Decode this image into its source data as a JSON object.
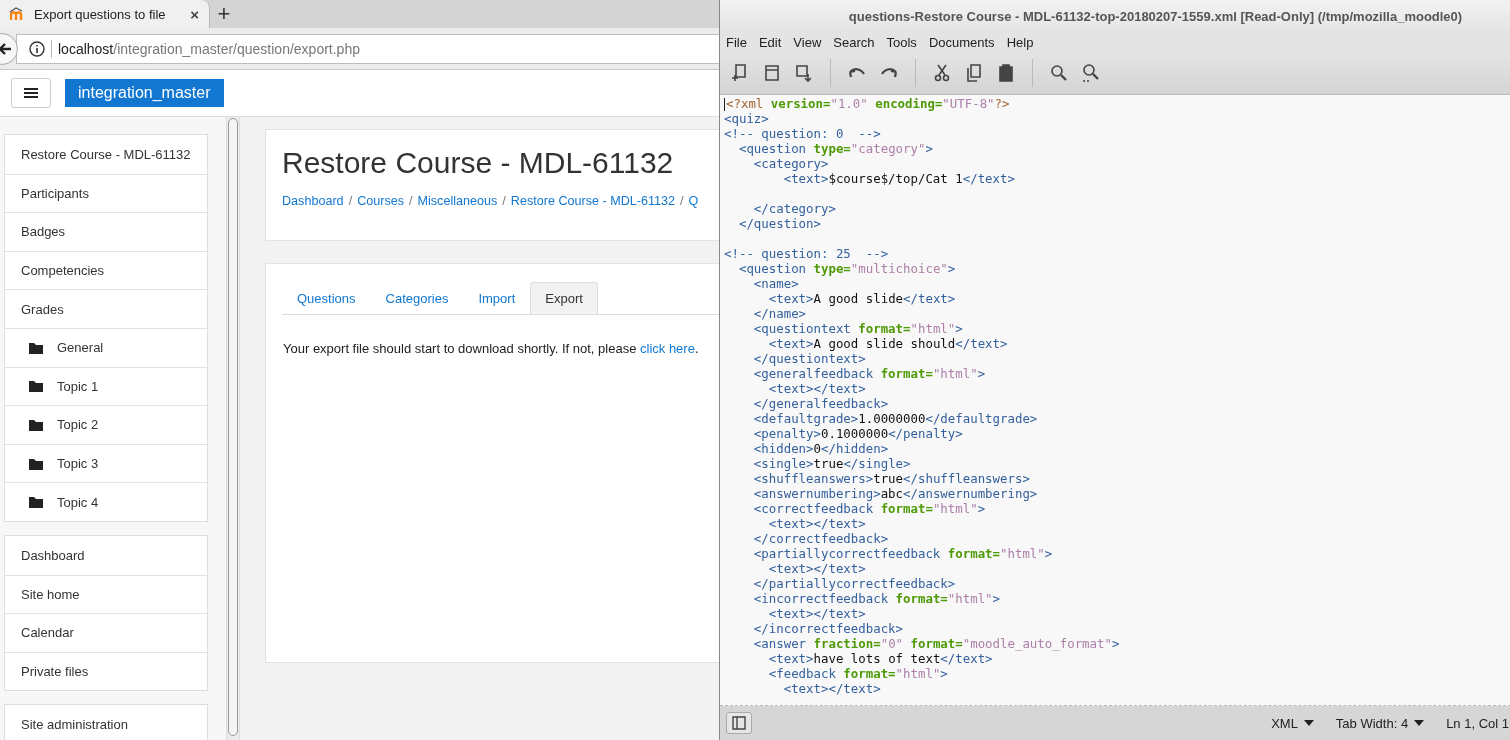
{
  "browser": {
    "tab": {
      "title": "Export questions to file",
      "close": "×"
    },
    "new_tab": "+",
    "address": {
      "host": "localhost",
      "path": "/integration_master/question/export.php"
    }
  },
  "navbar": {
    "brand": "integration_master"
  },
  "drawer": [
    {
      "items": [
        {
          "label": "Restore Course - MDL-61132",
          "kind": "link"
        },
        {
          "label": "Participants",
          "kind": "link"
        },
        {
          "label": "Badges",
          "kind": "link"
        },
        {
          "label": "Competencies",
          "kind": "link"
        },
        {
          "label": "Grades",
          "kind": "link"
        },
        {
          "label": "General",
          "kind": "folder"
        },
        {
          "label": "Topic 1",
          "kind": "folder"
        },
        {
          "label": "Topic 2",
          "kind": "folder"
        },
        {
          "label": "Topic 3",
          "kind": "folder"
        },
        {
          "label": "Topic 4",
          "kind": "folder"
        }
      ]
    },
    {
      "items": [
        {
          "label": "Dashboard",
          "kind": "link"
        },
        {
          "label": "Site home",
          "kind": "link"
        },
        {
          "label": "Calendar",
          "kind": "link"
        },
        {
          "label": "Private files",
          "kind": "link"
        }
      ]
    },
    {
      "items": [
        {
          "label": "Site administration",
          "kind": "link"
        }
      ]
    }
  ],
  "page": {
    "title": "Restore Course - MDL-61132",
    "breadcrumb": [
      {
        "label": "Dashboard",
        "separator": "/"
      },
      {
        "label": "Courses",
        "separator": "/"
      },
      {
        "label": "Miscellaneous",
        "separator": "/"
      },
      {
        "label": "Restore Course - MDL-61132",
        "separator": "/"
      },
      {
        "label": "Q"
      }
    ],
    "tabs": [
      {
        "label": "Questions",
        "selected": false
      },
      {
        "label": "Categories",
        "selected": false
      },
      {
        "label": "Import",
        "selected": false
      },
      {
        "label": "Export",
        "selected": true
      }
    ],
    "message": {
      "before": "Your export file should start to download shortly. If not, please ",
      "link": "click here",
      "after": "."
    }
  },
  "editor": {
    "title": "questions-Restore Course - MDL-61132-top-20180207-1559.xml [Read-Only] (/tmp/mozilla_moodle0)",
    "menu": [
      "File",
      "Edit",
      "View",
      "Search",
      "Tools",
      "Documents",
      "Help"
    ],
    "lines": [
      {
        "segments": [
          {
            "kind": "pi",
            "text": "<?xml "
          },
          {
            "kind": "attr",
            "text": "version="
          },
          {
            "kind": "val",
            "text": "\"1.0\" "
          },
          {
            "kind": "attr",
            "text": "encoding="
          },
          {
            "kind": "val",
            "text": "\"UTF-8\""
          },
          {
            "kind": "pi",
            "text": "?>"
          }
        ]
      },
      {
        "segments": [
          {
            "kind": "tag",
            "text": "<quiz>"
          }
        ]
      },
      {
        "segments": [
          {
            "kind": "com",
            "text": "<!-- question: 0  -->"
          }
        ]
      },
      {
        "segments": [
          {
            "kind": "tag",
            "text": "  <question "
          },
          {
            "kind": "attr",
            "text": "type="
          },
          {
            "kind": "val",
            "text": "\"category\""
          },
          {
            "kind": "tag",
            "text": ">"
          }
        ]
      },
      {
        "segments": [
          {
            "kind": "tag",
            "text": "    <category>"
          }
        ]
      },
      {
        "segments": [
          {
            "kind": "tag",
            "text": "        <text>"
          },
          {
            "kind": "txt",
            "text": "$course$/top/Cat 1"
          },
          {
            "kind": "tag",
            "text": "</text>"
          }
        ],
        "blank_after": true
      },
      {
        "segments": [
          {
            "kind": "tag",
            "text": "    </category>"
          }
        ]
      },
      {
        "segments": [
          {
            "kind": "tag",
            "text": "  </question>"
          }
        ],
        "blank_after": true
      },
      {
        "segments": [
          {
            "kind": "com",
            "text": "<!-- question: 25  -->"
          }
        ]
      },
      {
        "segments": [
          {
            "kind": "tag",
            "text": "  <question "
          },
          {
            "kind": "attr",
            "text": "type="
          },
          {
            "kind": "val",
            "text": "\"multichoice\""
          },
          {
            "kind": "tag",
            "text": ">"
          }
        ]
      },
      {
        "segments": [
          {
            "kind": "tag",
            "text": "    <name>"
          }
        ]
      },
      {
        "segments": [
          {
            "kind": "tag",
            "text": "      <text>"
          },
          {
            "kind": "txt",
            "text": "A good slide"
          },
          {
            "kind": "tag",
            "text": "</text>"
          }
        ]
      },
      {
        "segments": [
          {
            "kind": "tag",
            "text": "    </name>"
          }
        ]
      },
      {
        "segments": [
          {
            "kind": "tag",
            "text": "    <questiontext "
          },
          {
            "kind": "attr",
            "text": "format="
          },
          {
            "kind": "val",
            "text": "\"html\""
          },
          {
            "kind": "tag",
            "text": ">"
          }
        ]
      },
      {
        "segments": [
          {
            "kind": "tag",
            "text": "      <text>"
          },
          {
            "kind": "txt",
            "text": "A good slide should"
          },
          {
            "kind": "tag",
            "text": "</text>"
          }
        ]
      },
      {
        "segments": [
          {
            "kind": "tag",
            "text": "    </questiontext>"
          }
        ]
      },
      {
        "segments": [
          {
            "kind": "tag",
            "text": "    <generalfeedback "
          },
          {
            "kind": "attr",
            "text": "format="
          },
          {
            "kind": "val",
            "text": "\"html\""
          },
          {
            "kind": "tag",
            "text": ">"
          }
        ]
      },
      {
        "segments": [
          {
            "kind": "tag",
            "text": "      <text></text>"
          }
        ]
      },
      {
        "segments": [
          {
            "kind": "tag",
            "text": "    </generalfeedback>"
          }
        ]
      },
      {
        "segments": [
          {
            "kind": "tag",
            "text": "    <defaultgrade>"
          },
          {
            "kind": "txt",
            "text": "1.0000000"
          },
          {
            "kind": "tag",
            "text": "</defaultgrade>"
          }
        ]
      },
      {
        "segments": [
          {
            "kind": "tag",
            "text": "    <penalty>"
          },
          {
            "kind": "txt",
            "text": "0.1000000"
          },
          {
            "kind": "tag",
            "text": "</penalty>"
          }
        ]
      },
      {
        "segments": [
          {
            "kind": "tag",
            "text": "    <hidden>"
          },
          {
            "kind": "txt",
            "text": "0"
          },
          {
            "kind": "tag",
            "text": "</hidden>"
          }
        ]
      },
      {
        "segments": [
          {
            "kind": "tag",
            "text": "    <single>"
          },
          {
            "kind": "txt",
            "text": "true"
          },
          {
            "kind": "tag",
            "text": "</single>"
          }
        ]
      },
      {
        "segments": [
          {
            "kind": "tag",
            "text": "    <shuffleanswers>"
          },
          {
            "kind": "txt",
            "text": "true"
          },
          {
            "kind": "tag",
            "text": "</shuffleanswers>"
          }
        ]
      },
      {
        "segments": [
          {
            "kind": "tag",
            "text": "    <answernumbering>"
          },
          {
            "kind": "txt",
            "text": "abc"
          },
          {
            "kind": "tag",
            "text": "</answernumbering>"
          }
        ]
      },
      {
        "segments": [
          {
            "kind": "tag",
            "text": "    <correctfeedback "
          },
          {
            "kind": "attr",
            "text": "format="
          },
          {
            "kind": "val",
            "text": "\"html\""
          },
          {
            "kind": "tag",
            "text": ">"
          }
        ]
      },
      {
        "segments": [
          {
            "kind": "tag",
            "text": "      <text></text>"
          }
        ]
      },
      {
        "segments": [
          {
            "kind": "tag",
            "text": "    </correctfeedback>"
          }
        ]
      },
      {
        "segments": [
          {
            "kind": "tag",
            "text": "    <partiallycorrectfeedback "
          },
          {
            "kind": "attr",
            "text": "format="
          },
          {
            "kind": "val",
            "text": "\"html\""
          },
          {
            "kind": "tag",
            "text": ">"
          }
        ]
      },
      {
        "segments": [
          {
            "kind": "tag",
            "text": "      <text></text>"
          }
        ]
      },
      {
        "segments": [
          {
            "kind": "tag",
            "text": "    </partiallycorrectfeedback>"
          }
        ]
      },
      {
        "segments": [
          {
            "kind": "tag",
            "text": "    <incorrectfeedback "
          },
          {
            "kind": "attr",
            "text": "format="
          },
          {
            "kind": "val",
            "text": "\"html\""
          },
          {
            "kind": "tag",
            "text": ">"
          }
        ]
      },
      {
        "segments": [
          {
            "kind": "tag",
            "text": "      <text></text>"
          }
        ]
      },
      {
        "segments": [
          {
            "kind": "tag",
            "text": "    </incorrectfeedback>"
          }
        ]
      },
      {
        "segments": [
          {
            "kind": "tag",
            "text": "    <answer "
          },
          {
            "kind": "attr",
            "text": "fraction="
          },
          {
            "kind": "val",
            "text": "\"0\" "
          },
          {
            "kind": "attr",
            "text": "format="
          },
          {
            "kind": "val",
            "text": "\"moodle_auto_format\""
          },
          {
            "kind": "tag",
            "text": ">"
          }
        ]
      },
      {
        "segments": [
          {
            "kind": "tag",
            "text": "      <text>"
          },
          {
            "kind": "txt",
            "text": "have lots of text"
          },
          {
            "kind": "tag",
            "text": "</text>"
          }
        ]
      },
      {
        "segments": [
          {
            "kind": "tag",
            "text": "      <feedback "
          },
          {
            "kind": "attr",
            "text": "format="
          },
          {
            "kind": "val",
            "text": "\"html\""
          },
          {
            "kind": "tag",
            "text": ">"
          }
        ]
      },
      {
        "segments": [
          {
            "kind": "tag",
            "text": "        <text></text>"
          }
        ]
      }
    ],
    "status": {
      "language": "XML",
      "tab_width": "Tab Width: 4",
      "position": "Ln 1, Col 1"
    }
  }
}
